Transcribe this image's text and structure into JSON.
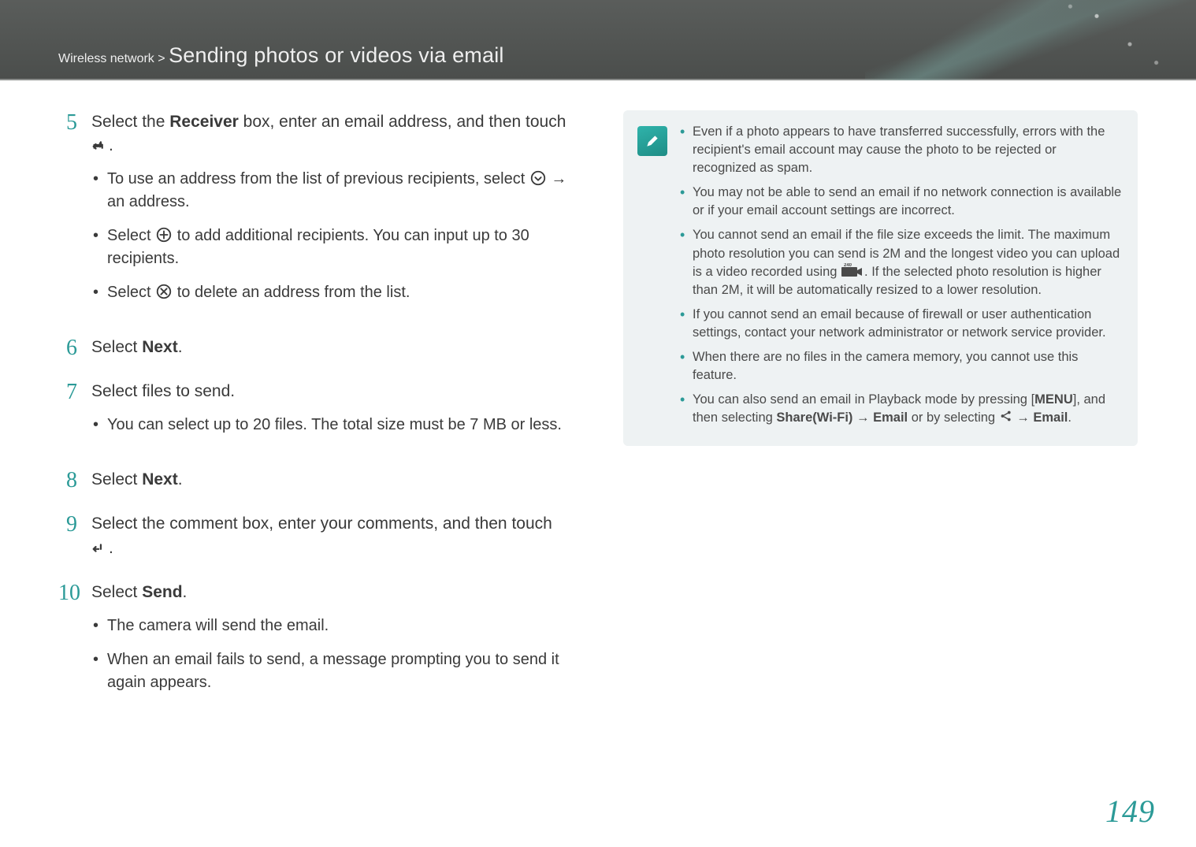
{
  "header": {
    "category": "Wireless network",
    "separator": ">",
    "title": "Sending photos or videos via email"
  },
  "steps": [
    {
      "num": "5",
      "text_parts": [
        "Select the ",
        "Receiver",
        " box, enter an email address, and then touch ",
        "."
      ],
      "subs": [
        {
          "pre": "To use an address from the list of previous recipients, select ",
          "post": " → an address.",
          "icon": "chevron-down-circle-icon"
        },
        {
          "pre": "Select ",
          "mid": " to add additional recipients. You can input up to 30 recipients.",
          "icon": "plus-circle-icon"
        },
        {
          "pre": "Select ",
          "mid": " to delete an address from the list.",
          "icon": "x-circle-icon"
        }
      ]
    },
    {
      "num": "6",
      "text_parts": [
        "Select ",
        "Next",
        "."
      ]
    },
    {
      "num": "7",
      "text_parts": [
        "Select files to send."
      ],
      "subs": [
        {
          "pre": "You can select up to 20 files. The total size must be 7 MB or less."
        }
      ]
    },
    {
      "num": "8",
      "text_parts": [
        "Select ",
        "Next",
        "."
      ]
    },
    {
      "num": "9",
      "text_parts": [
        "Select the comment box, enter your comments, and then touch ",
        "."
      ],
      "trailing_icon": "enter-icon"
    },
    {
      "num": "10",
      "text_parts": [
        "Select ",
        "Send",
        "."
      ],
      "subs": [
        {
          "pre": "The camera will send the email."
        },
        {
          "pre": "When an email fails to send, a message prompting you to send it again appears."
        }
      ]
    }
  ],
  "notes": [
    "Even if a photo appears to have transferred successfully, errors with the recipient's email account may cause the photo to be rejected or recognized as spam.",
    "You may not be able to send an email if no network connection is available or if your email account settings are incorrect.",
    "You cannot send an email if the file size exceeds the limit. The maximum photo resolution you can send is 2M and the longest video you can upload is a video recorded using [240-icon]. If the selected photo resolution is higher than 2M, it will be automatically resized to a lower resolution.",
    "If you cannot send an email because of firewall or user authentication settings, contact your network administrator or network service provider.",
    "When there are no files in the camera memory, you cannot use this feature.",
    "You can also send an email in Playback mode by pressing [MENU], and then selecting Share(Wi-Fi) → Email or by selecting [share-icon] → Email."
  ],
  "page_number": "149"
}
